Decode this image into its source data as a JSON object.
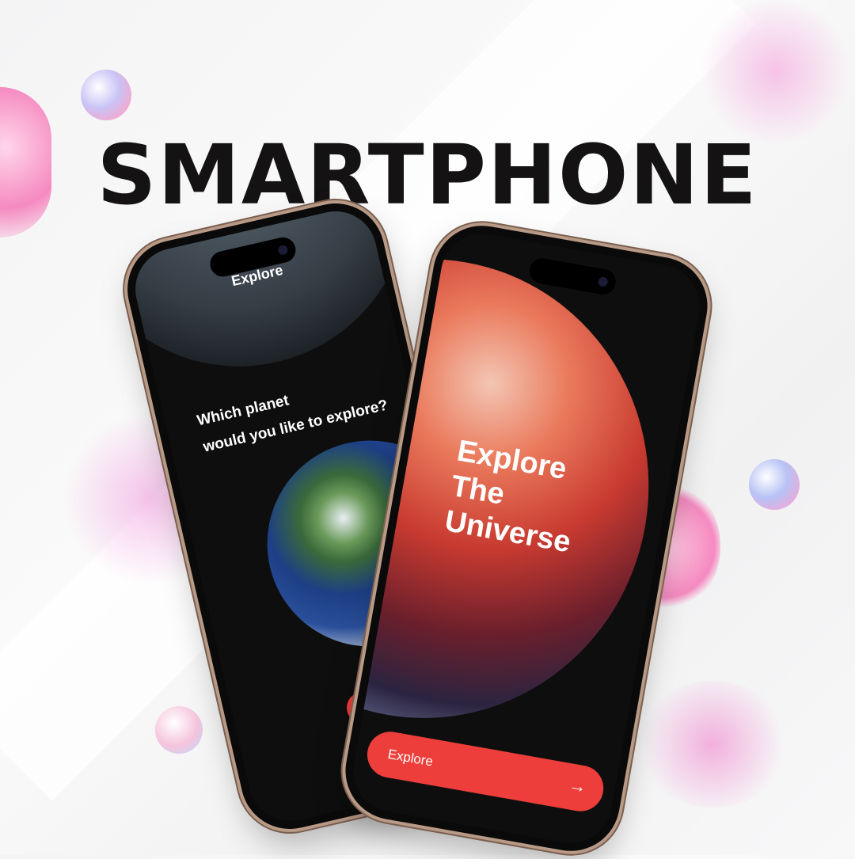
{
  "headline": "SMARTPHONE",
  "back_phone": {
    "header_label": "Explore",
    "question_line1": "Which planet",
    "question_line2": "would you like to explore?",
    "back_icon": "arrow-left-icon"
  },
  "front_phone": {
    "hero_line1": "Explore",
    "hero_line2": "The",
    "hero_line3": "Universe",
    "cta_label": "Explore",
    "cta_icon": "arrow-right-icon"
  },
  "colors": {
    "accent": "#ee3e3b",
    "background": "#f4f4f5",
    "title": "#141213"
  }
}
